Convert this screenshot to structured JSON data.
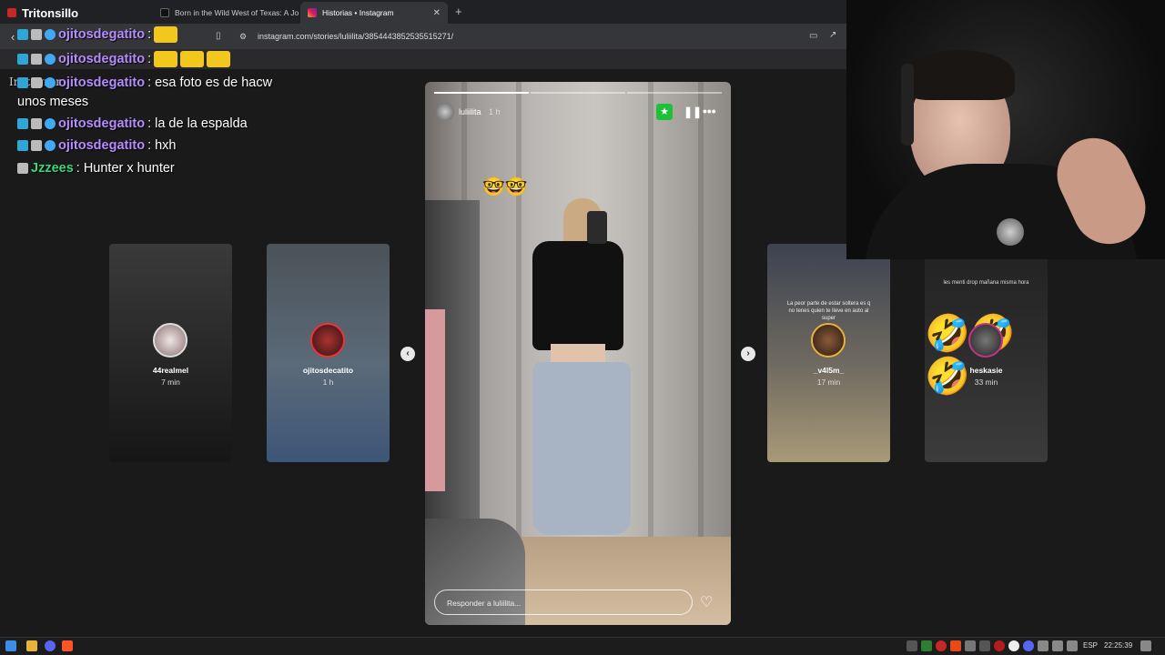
{
  "browser": {
    "tabs": [
      {
        "title": "Tritonsillo",
        "active": false
      },
      {
        "title": "Born in the Wild West of Texas: A Jou",
        "active": false
      },
      {
        "title": "Historias • Instagram",
        "active": true
      }
    ],
    "new_tab_label": "+",
    "url": "instagram.com/stories/luliilita/3854443852535515271/"
  },
  "chat": {
    "messages": [
      {
        "user": "ojitosdegatito",
        "text": ":",
        "user_color": "#b58cff"
      },
      {
        "user": "ojitosdegatito",
        "text": ":",
        "user_color": "#b58cff"
      },
      {
        "user": "ojitosdegatito",
        "text": ": esa foto es de hacw",
        "user_color": "#b58cff"
      },
      {
        "user": "",
        "text": "unos meses",
        "user_color": "#ffffff"
      },
      {
        "user": "ojitosdegatito",
        "text": ": la de la espalda",
        "user_color": "#b58cff"
      },
      {
        "user": "ojitosdegatito",
        "text": ": hxh",
        "user_color": "#b58cff"
      },
      {
        "user": "Jzzees",
        "text": ": Hunter x hunter",
        "user_color": "#37d67a"
      }
    ],
    "instagram_logo_text": "Instagram"
  },
  "main_story": {
    "username": "luliilita",
    "time": "1 h",
    "reply_placeholder": "Responder a luliilita...",
    "emoji": "🤓🤓",
    "progress_segments": 3,
    "progress_done": 1
  },
  "stories": [
    {
      "name": "44realmel",
      "time": "7 min"
    },
    {
      "name": "ojitosdecatito",
      "time": "1 h"
    },
    {
      "name": "_v4l5m_",
      "time": "17 min",
      "caption": "La peor parte de estar soltera es q no tenes quien te lleve en auto al super"
    },
    {
      "name": "heskasie",
      "time": "33 min",
      "caption": "les menti drop mañana misma hora"
    }
  ],
  "taskbar": {
    "language": "ESP",
    "clock": "22:25:39"
  }
}
